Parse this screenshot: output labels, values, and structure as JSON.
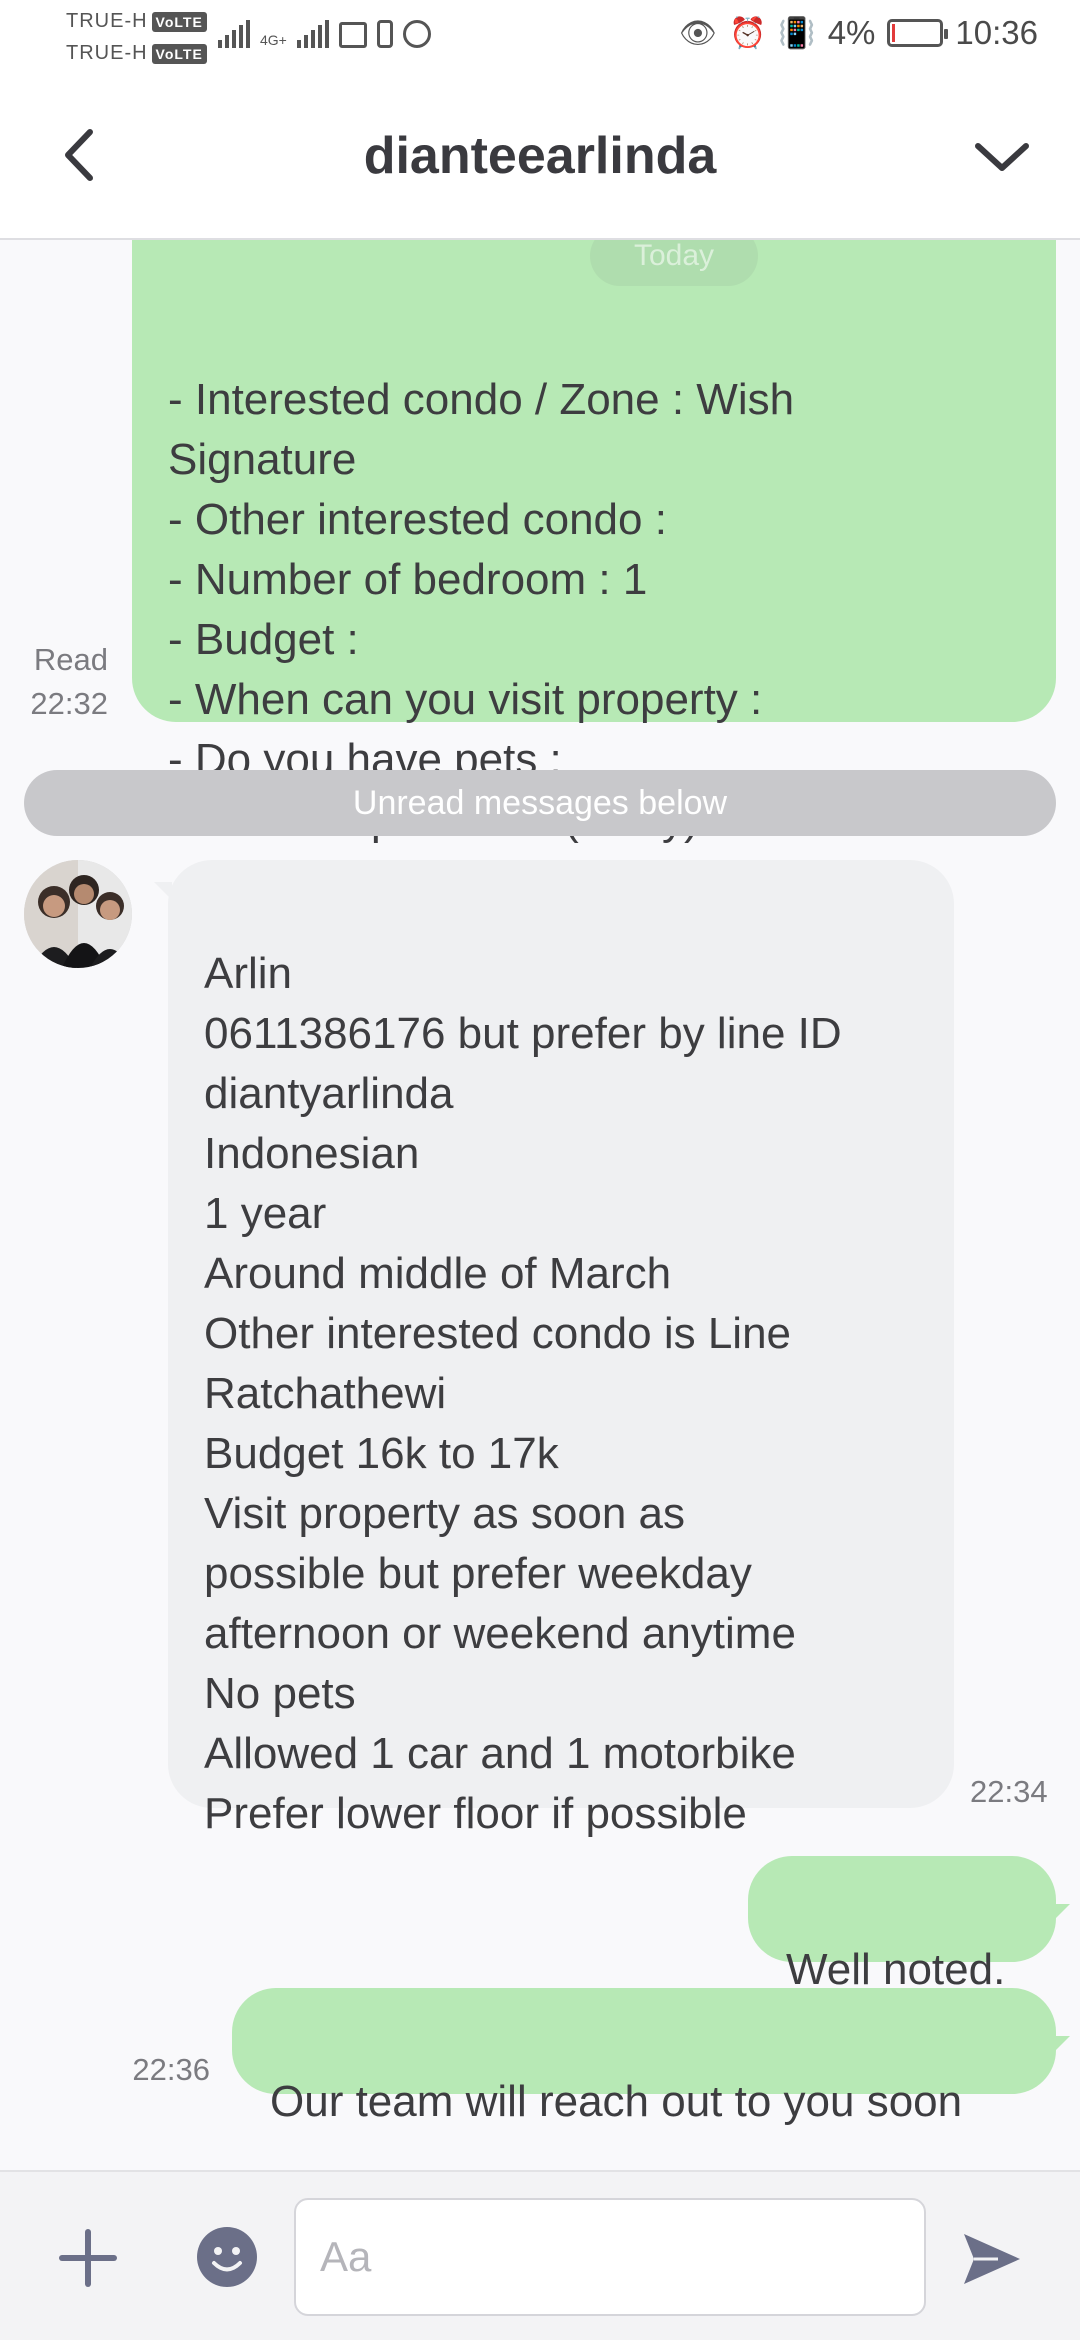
{
  "status_bar": {
    "carrier1": "TRUE-H",
    "carrier2": "TRUE-H",
    "volte_badge": "VoLTE",
    "network_label": "4G+",
    "battery_percent": "4%",
    "time": "10:36"
  },
  "header": {
    "title": "dianteearlinda"
  },
  "messages": {
    "m1": {
      "text": "- Interested condo / Zone : Wish\nSignature\n- Other interested condo :\n- Number of bedroom  : 1\n- Budget :\n- When can you visit property :\n- Do you have pets :\n- Other requirement (if any) :",
      "status": "Read",
      "time": "22:32"
    },
    "today_label": "Today",
    "unread_divider": "Unread messages below",
    "m2": {
      "text": "Arlin\n0611386176 but prefer by line ID\ndiantyarlinda\nIndonesian\n1 year\nAround middle of March\nOther interested condo is Line\nRatchathewi\nBudget 16k to 17k\nVisit property as soon as\npossible but prefer weekday\nafternoon or weekend anytime\nNo pets\nAllowed 1 car and 1 motorbike\nPrefer lower floor if possible",
      "time": "22:34"
    },
    "m3": {
      "text": "Well noted."
    },
    "m4": {
      "text": "Our team will reach out to you soon",
      "time": "22:36"
    }
  },
  "input_bar": {
    "placeholder": "Aa"
  },
  "colors": {
    "outgoing_bubble": "#b7e9b5",
    "incoming_bubble": "#eff0f2",
    "icon_color": "#6b6f88"
  }
}
